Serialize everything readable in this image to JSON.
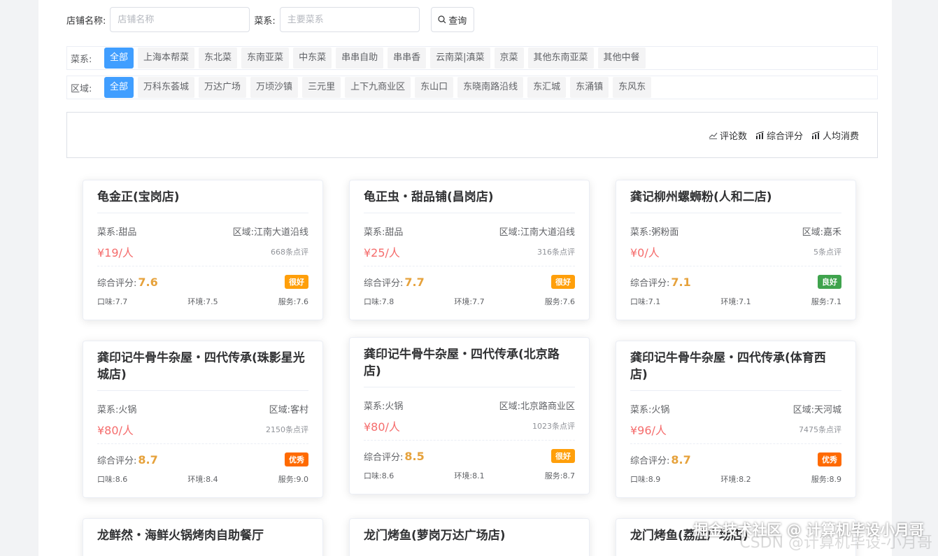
{
  "search": {
    "shop_label": "店铺名称:",
    "shop_placeholder": "店铺名称",
    "cuisine_label": "菜系:",
    "cuisine_placeholder": "主要菜系",
    "query_label": "查询"
  },
  "cuisine_filter": {
    "label": "菜系:",
    "tags": [
      "全部",
      "上海本帮菜",
      "东北菜",
      "东南亚菜",
      "中东菜",
      "串串自助",
      "串串香",
      "云南菜|滇菜",
      "京菜",
      "其他东南亚菜",
      "其他中餐"
    ]
  },
  "area_filter": {
    "label": "区域:",
    "tags": [
      "全部",
      "万科东荟城",
      "万达广场",
      "万顷沙镇",
      "三元里",
      "上下九商业区",
      "东山口",
      "东晓南路沿线",
      "东汇城",
      "东涌镇",
      "东风东"
    ]
  },
  "sort": {
    "reviews": "评论数",
    "overall": "综合评分",
    "avg_cost": "人均消费"
  },
  "labels": {
    "cuisine": "菜系:",
    "area": "区域:",
    "overall": "综合评分:",
    "taste": "口味:",
    "env": "环境:",
    "service": "服务:"
  },
  "colors": {
    "primary": "#409eff",
    "badge_very_good": "#ff9f0a",
    "badge_good": "#3fa34d",
    "badge_excellent": "#ff6a00"
  },
  "cards": [
    {
      "name": "龟金正(宝岗店)",
      "cuisine": "甜品",
      "area": "江南大道沿线",
      "price": "¥19/人",
      "reviews": "668条点评",
      "score": "7.6",
      "badge": "很好",
      "taste": "7.7",
      "env": "7.5",
      "service": "7.6"
    },
    {
      "name": "龟正虫・甜品铺(昌岗店)",
      "cuisine": "甜品",
      "area": "江南大道沿线",
      "price": "¥25/人",
      "reviews": "316条点评",
      "score": "7.7",
      "badge": "很好",
      "taste": "7.8",
      "env": "7.7",
      "service": "7.6"
    },
    {
      "name": "龚记柳州螺蛳粉(人和二店)",
      "cuisine": "粥粉面",
      "area": "嘉禾",
      "price": "¥0/人",
      "reviews": "5条点评",
      "score": "7.1",
      "badge": "良好",
      "taste": "7.1",
      "env": "7.1",
      "service": "7.1"
    },
    {
      "name": "龚印记牛骨牛杂屋・四代传承(珠影星光城店)",
      "cuisine": "火锅",
      "area": "客村",
      "price": "¥80/人",
      "reviews": "2150条点评",
      "score": "8.7",
      "badge": "优秀",
      "taste": "8.6",
      "env": "8.4",
      "service": "9.0"
    },
    {
      "name": "龚印记牛骨牛杂屋・四代传承(北京路店)",
      "cuisine": "火锅",
      "area": "北京路商业区",
      "price": "¥80/人",
      "reviews": "1023条点评",
      "score": "8.5",
      "badge": "很好",
      "taste": "8.6",
      "env": "8.1",
      "service": "8.7"
    },
    {
      "name": "龚印记牛骨牛杂屋・四代传承(体育西店)",
      "cuisine": "火锅",
      "area": "天河城",
      "price": "¥96/人",
      "reviews": "7475条点评",
      "score": "8.7",
      "badge": "优秀",
      "taste": "8.9",
      "env": "8.2",
      "service": "8.9"
    },
    {
      "name": "龙鲜然・海鲜火锅烤肉自助餐厅"
    },
    {
      "name": "龙门烤鱼(萝岗万达广场店)"
    },
    {
      "name": "龙门烤鱼(荔胜广场店)"
    }
  ],
  "watermark": "掘金技术社区 @ 计算机毕设小月哥",
  "watermark_faint": "CSDN @计算机毕设-小月哥"
}
